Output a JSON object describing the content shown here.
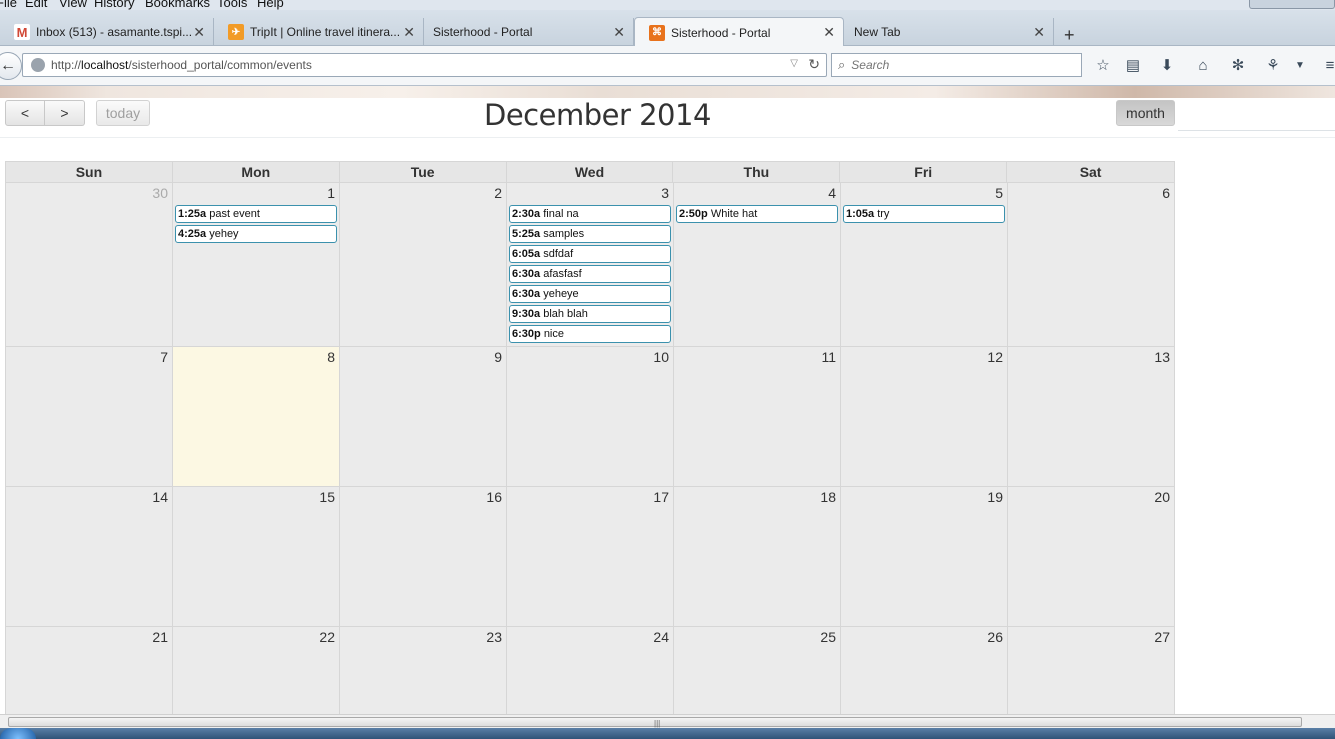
{
  "menubar": {
    "items": [
      "File",
      "Edit",
      "View",
      "History",
      "Bookmarks",
      "Tools",
      "Help"
    ]
  },
  "tabs": [
    {
      "label": "Inbox (513) - asamante.tspi...",
      "icon": "gmail-icon",
      "color": "#d14836"
    },
    {
      "label": "TripIt | Online travel itinera...",
      "icon": "tripit-icon",
      "color": "#f29b26"
    },
    {
      "label": "Sisterhood - Portal",
      "icon": "",
      "color": ""
    },
    {
      "label": "Sisterhood - Portal",
      "icon": "portal-icon",
      "color": "#e8721c"
    },
    {
      "label": "New Tab",
      "icon": "",
      "color": ""
    }
  ],
  "navbar": {
    "url_prefix": "http://",
    "url_host": "localhost",
    "url_path": "/sisterhood_portal/common/events",
    "search_placeholder": "Search"
  },
  "calendar": {
    "title": "December 2014",
    "today_label": "today",
    "month_label": "month",
    "prev_symbol": "<",
    "next_symbol": ">",
    "weekdays": [
      "Sun",
      "Mon",
      "Tue",
      "Wed",
      "Thu",
      "Fri",
      "Sat"
    ],
    "weeks": [
      {
        "days": [
          {
            "num": "30",
            "other": true,
            "events": []
          },
          {
            "num": "1",
            "events": [
              {
                "time": "1:25a",
                "title": "past event"
              },
              {
                "time": "4:25a",
                "title": "yehey"
              }
            ]
          },
          {
            "num": "2",
            "events": []
          },
          {
            "num": "3",
            "events": [
              {
                "time": "2:30a",
                "title": "final na"
              },
              {
                "time": "5:25a",
                "title": "samples"
              },
              {
                "time": "6:05a",
                "title": "sdfdaf"
              },
              {
                "time": "6:30a",
                "title": "afasfasf"
              },
              {
                "time": "6:30a",
                "title": "yeheye"
              },
              {
                "time": "9:30a",
                "title": "blah blah"
              },
              {
                "time": "6:30p",
                "title": "nice"
              }
            ]
          },
          {
            "num": "4",
            "events": [
              {
                "time": "2:50p",
                "title": "White hat"
              }
            ]
          },
          {
            "num": "5",
            "events": [
              {
                "time": "1:05a",
                "title": "try"
              }
            ]
          },
          {
            "num": "6",
            "events": []
          }
        ]
      },
      {
        "days": [
          {
            "num": "7",
            "events": []
          },
          {
            "num": "8",
            "today": true,
            "events": []
          },
          {
            "num": "9",
            "events": []
          },
          {
            "num": "10",
            "events": []
          },
          {
            "num": "11",
            "events": []
          },
          {
            "num": "12",
            "events": []
          },
          {
            "num": "13",
            "events": []
          }
        ]
      },
      {
        "days": [
          {
            "num": "14",
            "events": []
          },
          {
            "num": "15",
            "events": []
          },
          {
            "num": "16",
            "events": []
          },
          {
            "num": "17",
            "events": []
          },
          {
            "num": "18",
            "events": []
          },
          {
            "num": "19",
            "events": []
          },
          {
            "num": "20",
            "events": []
          }
        ]
      },
      {
        "days": [
          {
            "num": "21",
            "events": []
          },
          {
            "num": "22",
            "events": []
          },
          {
            "num": "23",
            "events": []
          },
          {
            "num": "24",
            "events": []
          },
          {
            "num": "25",
            "events": []
          },
          {
            "num": "26",
            "events": []
          },
          {
            "num": "27",
            "events": []
          }
        ]
      }
    ]
  }
}
